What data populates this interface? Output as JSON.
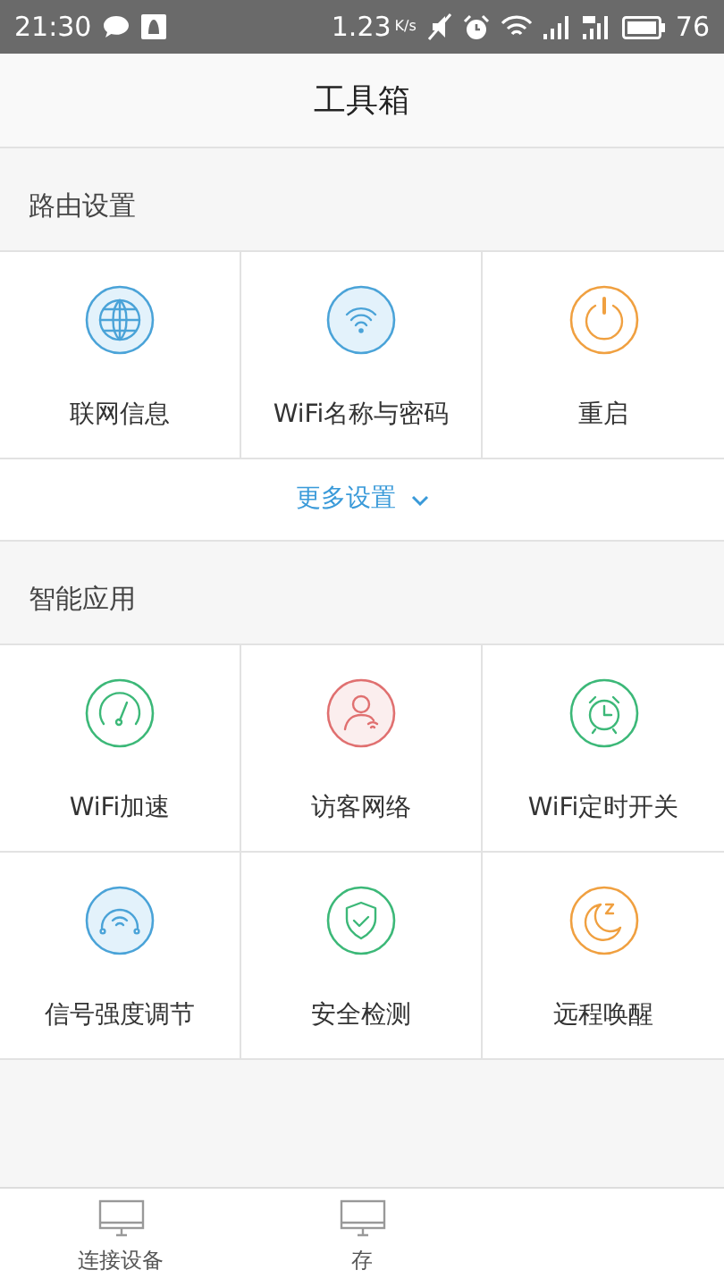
{
  "status_bar": {
    "time": "21:30",
    "speed": "1.23",
    "speed_unit": "K/s",
    "battery": "76"
  },
  "title": "工具箱",
  "sections": [
    {
      "heading": "路由设置",
      "items": [
        {
          "kind": "globe",
          "label": "联网信息"
        },
        {
          "kind": "wifi",
          "label": "WiFi名称与密码"
        },
        {
          "kind": "power",
          "label": "重启"
        }
      ],
      "more": "更多设置"
    },
    {
      "heading": "智能应用",
      "items": [
        {
          "kind": "gauge",
          "label": "WiFi加速"
        },
        {
          "kind": "guest",
          "label": "访客网络"
        },
        {
          "kind": "alarm",
          "label": "WiFi定时开关"
        },
        {
          "kind": "signal",
          "label": "信号强度调节"
        },
        {
          "kind": "shield",
          "label": "安全检测"
        },
        {
          "kind": "moon",
          "label": "远程唤醒"
        }
      ]
    }
  ],
  "bottom_nav": [
    {
      "label": "连接设备"
    },
    {
      "label": "存"
    }
  ]
}
